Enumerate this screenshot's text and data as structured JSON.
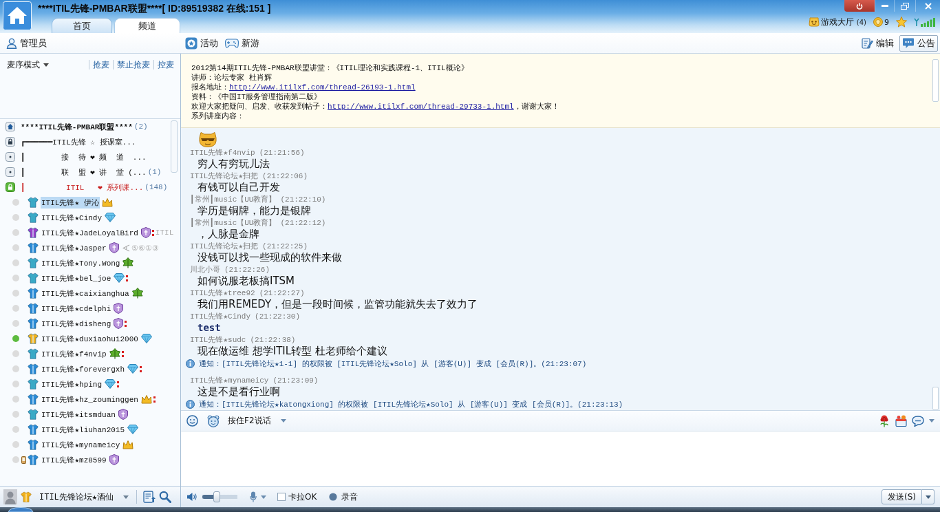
{
  "window": {
    "title": "****ITIL先锋-PMBAR联盟****[ ID:89519382 在线:151 ]"
  },
  "tabs": [
    {
      "label": "首页",
      "selected": false
    },
    {
      "label": "频道",
      "selected": true
    }
  ],
  "status_bar": {
    "game_hall": {
      "label": "游戏大厅",
      "count": "(4)"
    },
    "coins": "9"
  },
  "toolbar": {
    "role": "管理员",
    "actions": [
      {
        "kind": "activity",
        "label": "活动"
      },
      {
        "kind": "games",
        "label": "新游"
      }
    ],
    "tools": [
      {
        "kind": "edit",
        "label": "编辑",
        "selected": false
      },
      {
        "kind": "notice",
        "label": "公告",
        "selected": true
      }
    ]
  },
  "mic_panel": {
    "mode": "麦序模式",
    "links": [
      "抢麦",
      "禁止抢麦",
      "控麦"
    ]
  },
  "channel_tree": {
    "name": "****ITIL先锋-PMBAR联盟****",
    "count": "(2)",
    "children": [
      {
        "name": "┏━━━━━━ITIL先锋 ☆ 授课室...",
        "kind": "locked",
        "selected": false
      },
      {
        "name": "┃        接  待 ❤ 频  道  ...",
        "kind": "open",
        "selected": false
      },
      {
        "name": "┃        联  盟 ❤ 讲  堂 (...",
        "count": "(1)",
        "kind": "open",
        "selected": false
      },
      {
        "name": "┃         ITIL   ❤ 系列课...",
        "count": "(148)",
        "kind": "locked",
        "selected": true,
        "children": [
          {
            "name": "ITIL先锋★ 伊沁",
            "shirt": {
              "kind": "member"
            },
            "badge": {
              "kind": "crown"
            },
            "color": "#dcdcdc",
            "selected": true,
            "marked": false,
            "mobile": false
          },
          {
            "name": "ITIL先锋★Cindy",
            "shirt": {
              "kind": "member"
            },
            "badge": {
              "kind": "diamond"
            },
            "color": "#dcdcdc",
            "selected": false,
            "marked": false,
            "mobile": false
          },
          {
            "name": "ITIL先锋★JadeLoyalBird",
            "shirt": {
              "kind": "vip"
            },
            "badge": {
              "kind": "shield"
            },
            "color": "#dcdcdc",
            "selected": false,
            "marked": true,
            "mobile": false,
            "extra": {
              "kind": "tag",
              "text": "ITIL"
            }
          },
          {
            "name": "ITIL先锋★Jasper",
            "shirt": {
              "kind": "registered"
            },
            "badge": {
              "kind": "shield"
            },
            "color": "#dcdcdc",
            "selected": false,
            "marked": false,
            "mobile": false,
            "extra": {
              "kind": "rank",
              "text": "⑤⑥①③"
            }
          },
          {
            "name": "ITIL先锋★Tony.Wong",
            "shirt": {
              "kind": "member"
            },
            "badge": {
              "kind": "leaf"
            },
            "color": "#dcdcdc",
            "selected": false,
            "marked": false,
            "mobile": false
          },
          {
            "name": "ITIL先锋★bel_joe",
            "shirt": {
              "kind": "member"
            },
            "badge": {
              "kind": "diamond"
            },
            "color": "#dcdcdc",
            "selected": false,
            "marked": true,
            "mobile": false
          },
          {
            "name": "ITIL先锋★caixianghua",
            "shirt": {
              "kind": "registered"
            },
            "badge": {
              "kind": "leaf"
            },
            "color": "#dcdcdc",
            "selected": false,
            "marked": false,
            "mobile": false
          },
          {
            "name": "ITIL先锋★cdelphi",
            "shirt": {
              "kind": "registered"
            },
            "badge": {
              "kind": "shield"
            },
            "color": "#dcdcdc",
            "selected": false,
            "marked": false,
            "mobile": false
          },
          {
            "name": "ITIL先锋★disheng",
            "shirt": {
              "kind": "registered"
            },
            "badge": {
              "kind": "shield"
            },
            "color": "#dcdcdc",
            "selected": false,
            "marked": true,
            "mobile": false
          },
          {
            "name": "ITIL先锋★duxiaohui2000",
            "shirt": {
              "kind": "host"
            },
            "badge": {
              "kind": "diamond"
            },
            "color": "#5dbb3f",
            "selected": false,
            "marked": false,
            "mobile": false
          },
          {
            "name": "ITIL先锋★f4nvip",
            "shirt": {
              "kind": "member"
            },
            "badge": {
              "kind": "leaf"
            },
            "color": "#dcdcdc",
            "selected": false,
            "marked": true,
            "mobile": false
          },
          {
            "name": "ITIL先锋★forevergxh",
            "shirt": {
              "kind": "registered"
            },
            "badge": {
              "kind": "diamond"
            },
            "color": "#dcdcdc",
            "selected": false,
            "marked": true,
            "mobile": false
          },
          {
            "name": "ITIL先锋★hping",
            "shirt": {
              "kind": "member"
            },
            "badge": {
              "kind": "diamond"
            },
            "color": "#dcdcdc",
            "selected": false,
            "marked": true,
            "mobile": false
          },
          {
            "name": "ITIL先锋★hz_zouminggen",
            "shirt": {
              "kind": "registered"
            },
            "badge": {
              "kind": "crown"
            },
            "color": "#dcdcdc",
            "selected": false,
            "marked": true,
            "mobile": false
          },
          {
            "name": "ITIL先锋★itsmduan",
            "shirt": {
              "kind": "member"
            },
            "badge": {
              "kind": "shield"
            },
            "color": "#dcdcdc",
            "selected": false,
            "marked": false,
            "mobile": false
          },
          {
            "name": "ITIL先锋★liuhan2015",
            "shirt": {
              "kind": "registered"
            },
            "badge": {
              "kind": "diamond"
            },
            "color": "#dcdcdc",
            "selected": false,
            "marked": false,
            "mobile": false
          },
          {
            "name": "ITIL先锋★mynameicy",
            "shirt": {
              "kind": "registered"
            },
            "badge": {
              "kind": "crown"
            },
            "color": "#dcdcdc",
            "selected": false,
            "marked": false,
            "mobile": false
          },
          {
            "name": "ITIL先锋★mz8599",
            "shirt": {
              "kind": "registered"
            },
            "badge": {
              "kind": "shield"
            },
            "color": "#dcdcdc",
            "selected": false,
            "marked": false,
            "mobile": true
          }
        ]
      }
    ]
  },
  "announcement": {
    "lines": [
      {
        "text": "2012第14期ITIL先锋-PMBAR联盟讲堂：《ITIL理论和实践课程-1、ITIL概论》"
      },
      {
        "text": "讲师：论坛专家 杜肖辉"
      },
      {
        "text": "报名地址：",
        "link": "http://www.itilxf.com/thread-26193-1.html"
      },
      {
        "text": "资料：《中国IT服务管理指南第二版》"
      },
      {
        "text": "欢迎大家把疑问、启发、收获发到帖子：",
        "link": "http://www.itilxf.com/thread-29733-1.html",
        "tail": "，谢谢大家！"
      },
      {
        "text": "系列讲座内容："
      }
    ]
  },
  "messages": [
    {
      "kind": "sticker"
    },
    {
      "kind": "chat",
      "sender": "ITIL先锋★f4nvip",
      "time": "(21:21:56)",
      "text": "穷人有穷玩儿法",
      "bold": false
    },
    {
      "kind": "chat",
      "sender": "ITIL先锋论坛★扫把",
      "time": "(21:22:06)",
      "text": "有钱可以自己开发",
      "bold": false
    },
    {
      "kind": "chat",
      "sender": "┃常州┃music【UU教育】",
      "time": "(21:22:10)",
      "text": "学历是铜牌，能力是银牌",
      "bold": false
    },
    {
      "kind": "chat",
      "sender": "┃常州┃music【UU教育】",
      "time": "(21:22:12)",
      "text": "，人脉是金牌",
      "bold": false
    },
    {
      "kind": "chat",
      "sender": "ITIL先锋论坛★扫把",
      "time": "(21:22:25)",
      "text": "没钱可以找一些现成的软件来做",
      "bold": false
    },
    {
      "kind": "chat",
      "sender": "川北小哥",
      "time": "(21:22:26)",
      "text": "如何说服老板搞ITSM",
      "bold": false
    },
    {
      "kind": "chat",
      "sender": "ITIL先锋★tree92",
      "time": "(21:22:27)",
      "text": "我们用REMEDY，但是一段时间候，监管功能就失去了效力了",
      "bold": false
    },
    {
      "kind": "chat",
      "sender": "ITIL先锋★Cindy",
      "time": "(21:22:30)",
      "text": "test",
      "bold": true
    },
    {
      "kind": "chat",
      "sender": "ITIL先锋★sudc",
      "time": "(21:22:38)",
      "text": "现在做运维 想学ITIL转型 杜老师给个建议",
      "bold": false
    },
    {
      "kind": "notice",
      "text": "通知：[ITIL先锋论坛★1-1] 的权限被 [ITIL先锋论坛★Solo] 从 [游客(U)] 变成 [会员(R)]。(21:23:07)"
    },
    {
      "kind": "chat",
      "sender": "ITIL先锋★mynameicy",
      "time": "(21:23:09)",
      "text": "这是不是看行业啊",
      "bold": false
    },
    {
      "kind": "notice",
      "text": "通知：[ITIL先锋论坛★katongxiong] 的权限被 [ITIL先锋论坛★Solo] 从 [游客(U)] 变成 [会员(R)]。(21:23:13)"
    }
  ],
  "input_toolbar": {
    "talk_mode": "按住F2说话"
  },
  "user_bar": {
    "name": "ITIL先锋论坛★酒仙",
    "shirt": {
      "kind": "host"
    }
  },
  "audio": {
    "volume": {
      "level": 0.42
    },
    "karaoke": {
      "label": "卡拉OK",
      "checked": false
    },
    "record": {
      "label": "录音"
    }
  },
  "send": {
    "label": "发送(S)"
  }
}
